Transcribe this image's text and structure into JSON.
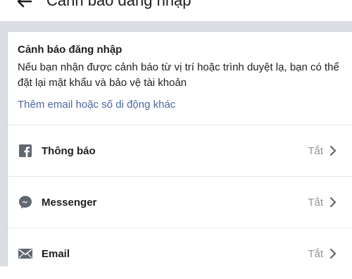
{
  "header": {
    "title": "Cảnh báo đăng nhập"
  },
  "card": {
    "title": "Cảnh báo đăng nhập",
    "description": "Nếu bạn nhận được cảnh báo từ vị trí hoặc trình duyệt lạ, bạn có thể đặt lại mật khẩu và bảo vệ tài khoản",
    "link": "Thêm email hoặc số di động khác"
  },
  "rows": [
    {
      "label": "Thông báo",
      "status": "Tắt",
      "icon": "facebook-icon"
    },
    {
      "label": "Messenger",
      "status": "Tắt",
      "icon": "messenger-icon"
    },
    {
      "label": "Email",
      "status": "Tắt",
      "icon": "envelope-icon"
    }
  ],
  "colors": {
    "background": "#dadde1",
    "card": "#ffffff",
    "link": "#4b67a1",
    "muted": "#90949c",
    "icon": "#606770"
  }
}
